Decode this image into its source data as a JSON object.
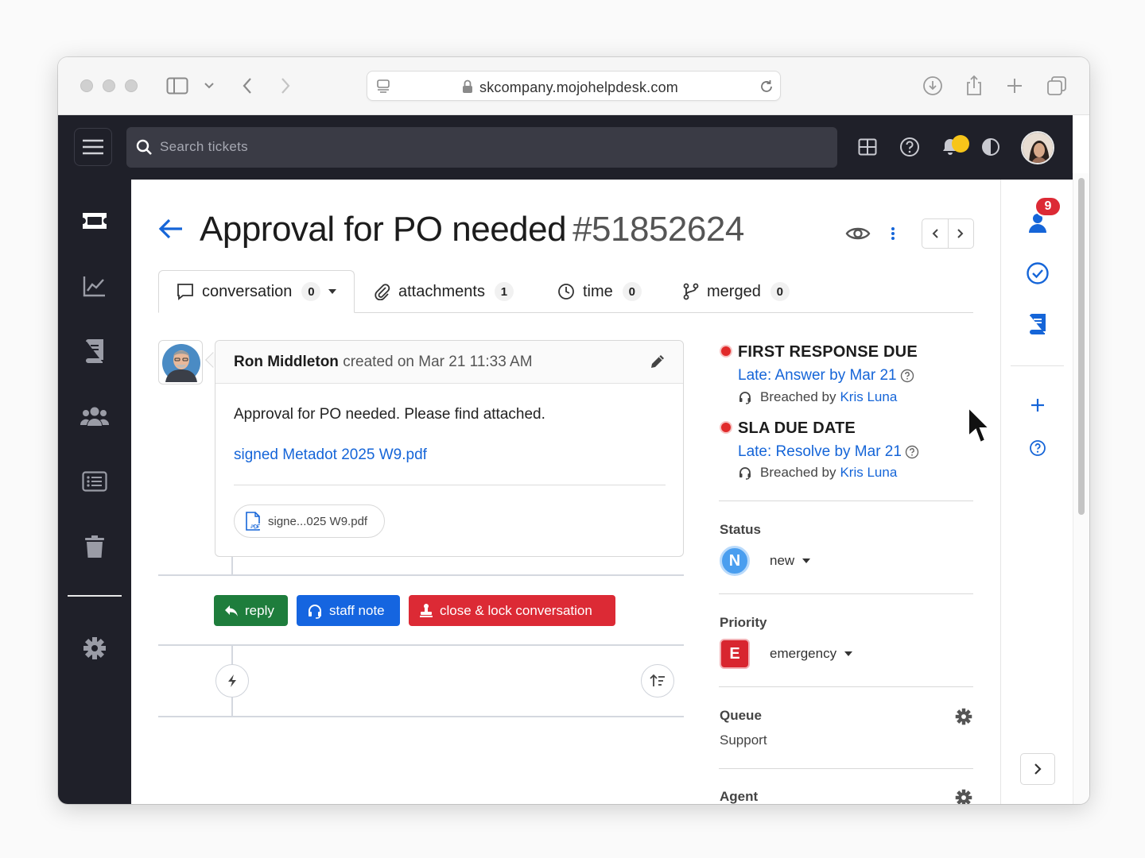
{
  "browser": {
    "url": "skcompany.mojohelpdesk.com"
  },
  "topbar": {
    "search_placeholder": "Search tickets"
  },
  "ticket": {
    "title": "Approval for PO needed",
    "number": "#51852624"
  },
  "tabs": [
    {
      "label": "conversation",
      "count": "0"
    },
    {
      "label": "attachments",
      "count": "1"
    },
    {
      "label": "time",
      "count": "0"
    },
    {
      "label": "merged",
      "count": "0"
    }
  ],
  "message": {
    "author": "Ron Middleton",
    "meta": "created on Mar 21 11:33 AM",
    "body": "Approval for PO needed. Please find attached.",
    "attachment_link": "signed Metadot 2025 W9.pdf",
    "attachment_chip": "signe...025 W9.pdf"
  },
  "actions": {
    "reply": "reply",
    "staff_note": "staff note",
    "close_lock": "close & lock conversation"
  },
  "sla": [
    {
      "title": "FIRST RESPONSE DUE",
      "late": "Late: Answer by Mar 21",
      "breached_prefix": "Breached by",
      "breached_by": "Kris Luna"
    },
    {
      "title": "SLA DUE DATE",
      "late": "Late: Resolve by Mar 21",
      "breached_prefix": "Breached by",
      "breached_by": "Kris Luna"
    }
  ],
  "fields": {
    "status_label": "Status",
    "status_badge": "N",
    "status_value": "new",
    "priority_label": "Priority",
    "priority_badge": "E",
    "priority_value": "emergency",
    "queue_label": "Queue",
    "queue_value": "Support",
    "agent_label": "Agent"
  },
  "rail": {
    "notification_count": "9"
  },
  "colors": {
    "accent_blue": "#1565d8",
    "reply_green": "#1e7d3c",
    "note_blue": "#1565e0",
    "danger_red": "#dc2a35",
    "sidebar_dark": "#1f2029",
    "bell_dot_yellow": "#f7c51a"
  }
}
